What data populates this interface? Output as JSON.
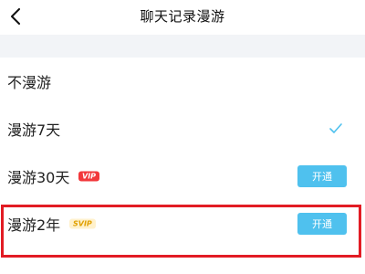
{
  "header": {
    "title": "聊天记录漫游",
    "back_icon": "chevron-left-icon"
  },
  "options": [
    {
      "label": "不漫游",
      "badge": "",
      "selected": false,
      "action": ""
    },
    {
      "label": "漫游7天",
      "badge": "",
      "selected": true,
      "action": ""
    },
    {
      "label": "漫游30天",
      "badge": "VIP",
      "selected": false,
      "action": "开通"
    },
    {
      "label": "漫游2年",
      "badge": "SVIP",
      "selected": false,
      "action": "开通"
    }
  ],
  "colors": {
    "accent": "#4fc1ee",
    "vip_badge": "#f2383b",
    "svip_badge_bg": "#fff1cc",
    "svip_badge_text": "#e0a000",
    "highlight_border": "#e21c24",
    "check": "#4fc1ee"
  },
  "icons": {
    "selected": "checkmark-icon"
  }
}
